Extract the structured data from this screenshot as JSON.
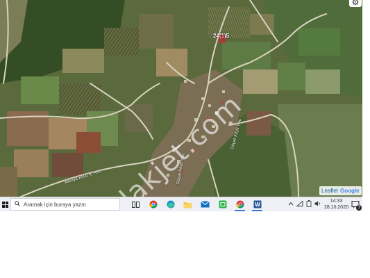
{
  "map": {
    "parcel_label": "24(1)5",
    "watermark": "emlakjet.com",
    "road_labels": [
      "Akkaya Köyü İç Yolu",
      "Göçeli Köyü Yolu",
      "Göçeli Köyü Yolu"
    ],
    "attribution": {
      "leaflet": "Leaflet",
      "google": "Google"
    },
    "settings_icon": "gear-icon"
  },
  "taskbar": {
    "start_icon": "windows-logo-icon",
    "search_placeholder": "Aramak için buraya yazın",
    "apps": [
      {
        "name": "task-view-icon",
        "active": false
      },
      {
        "name": "chrome-icon",
        "active": false
      },
      {
        "name": "edge-icon",
        "active": false
      },
      {
        "name": "file-explorer-icon",
        "active": false
      },
      {
        "name": "mail-icon",
        "active": false
      },
      {
        "name": "green-app-icon",
        "active": false
      },
      {
        "name": "chrome-profile-icon",
        "active": true
      },
      {
        "name": "word-icon",
        "active": true
      }
    ],
    "tray": {
      "time": "14:33",
      "date": "28.10.2020",
      "notifications": "3"
    }
  },
  "colors": {
    "field_dark": "#3f5a2c",
    "field_light": "#8a8f62",
    "road": "#d9d5c4",
    "taskbar_bg": "#eef0f5"
  }
}
